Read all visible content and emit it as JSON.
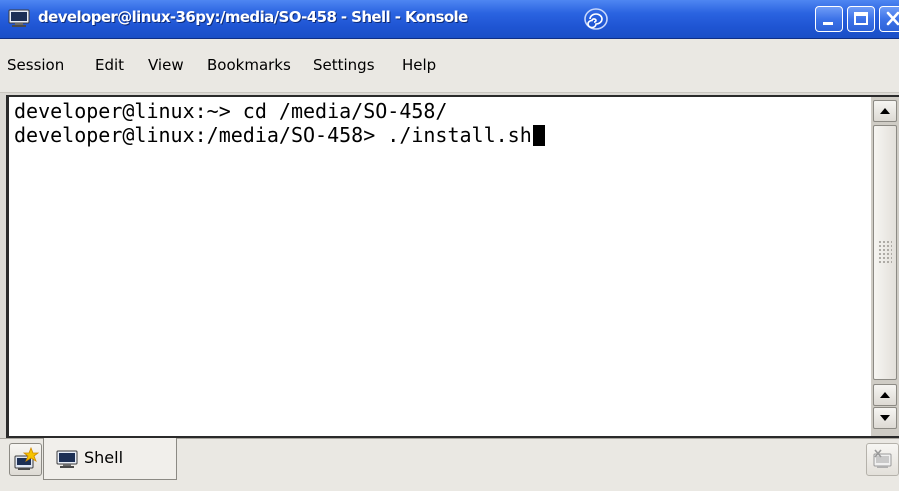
{
  "window": {
    "title": "developer@linux-36py:/media/SO-458 - Shell - Konsole"
  },
  "menubar": {
    "items": [
      "Session",
      "Edit",
      "View",
      "Bookmarks",
      "Settings",
      "Help"
    ]
  },
  "terminal": {
    "lines": [
      "developer@linux:~> cd /media/SO-458/",
      "developer@linux:/media/SO-458> ./install.sh"
    ]
  },
  "tabs": [
    {
      "label": "Shell",
      "icon": "terminal-icon"
    }
  ],
  "icons": {
    "app": "terminal-icon",
    "title_decoration": "spiral-icon",
    "minimize": "minimize-icon",
    "maximize": "maximize-icon",
    "close": "close-icon",
    "scroll_up": "arrow-up-icon",
    "scroll_down": "arrow-down-icon",
    "new_session": "new-session-icon",
    "close_session": "close-session-icon"
  },
  "colors": {
    "titlebar": "#2a63e0",
    "terminal_background": "#ffffff",
    "terminal_text": "#000000"
  }
}
